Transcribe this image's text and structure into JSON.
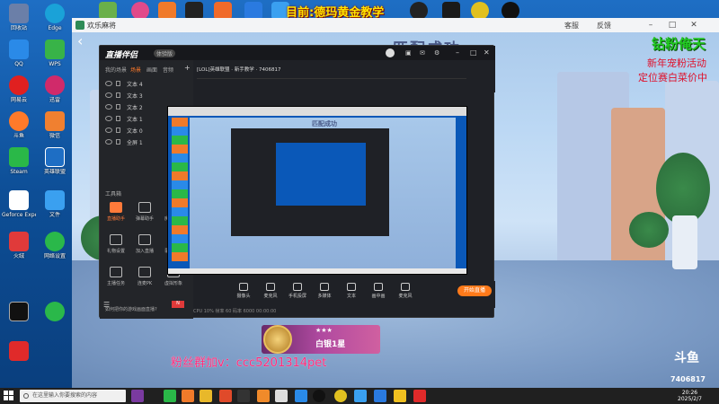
{
  "stream_title": "目前:德玛黄金教学",
  "game": {
    "app_name": "欢乐麻将",
    "titlebar_right": [
      "客服",
      "反馈"
    ],
    "match_title": "匹配成功",
    "rank_stars": "★★★",
    "rank_name": "白银1星"
  },
  "overlays": {
    "diamond": "钻粉俺天",
    "promo_line1": "新年宠粉活动",
    "promo_line2": "定位赛白菜价中",
    "fans_group": "粉丝群加v：ccc5201314pet",
    "douyu_logo": "斗鱼",
    "douyu_id": "7406817"
  },
  "desktop_icons": [
    "回收站",
    "Edge",
    "QQ",
    "WPS",
    "网易云",
    "迅雷",
    "斗鱼",
    "微信",
    "Steam",
    "英雄联盟",
    "Geforce Experience",
    "文件",
    "火绒",
    "网络设置"
  ],
  "stream_app": {
    "logo": "直播伴侣",
    "version": "体验版",
    "tabs": [
      "我的场景",
      "场景",
      "画面",
      "音频"
    ],
    "scenes": [
      "文本 4",
      "文本 3",
      "文本 2",
      "文本 1",
      "文本 0",
      "全屏 1"
    ],
    "tools_title": "工具箱",
    "tools": [
      {
        "label": "直播助手",
        "hot": true
      },
      {
        "label": "弹幕助手",
        "hot": false
      },
      {
        "label": "房管助手",
        "hot": false
      },
      {
        "label": "礼物设置",
        "hot": false
      },
      {
        "label": "加入直播",
        "hot": false
      },
      {
        "label": "录屏助手",
        "hot": false
      },
      {
        "label": "主播任务",
        "hot": false
      },
      {
        "label": "连麦PK",
        "hot": false
      },
      {
        "label": "虚拟形象",
        "hot": false
      }
    ],
    "help": "如何把你的游戏画面直播?",
    "top_info": "[LOL]英雄联盟 · 新手教学 · 7406817",
    "bottom_items": [
      "摄像头",
      "麦克风",
      "手机投屏",
      "多媒体",
      "文本",
      "画中画",
      "麦克风"
    ],
    "start_live": "开始直播",
    "status": "CPU 10%   帧率 60   码率 6000   00:00:00"
  },
  "taskbar": {
    "search_placeholder": "在这里输入你要搜索的内容",
    "time": "20:26",
    "date": "2025/2/7"
  }
}
